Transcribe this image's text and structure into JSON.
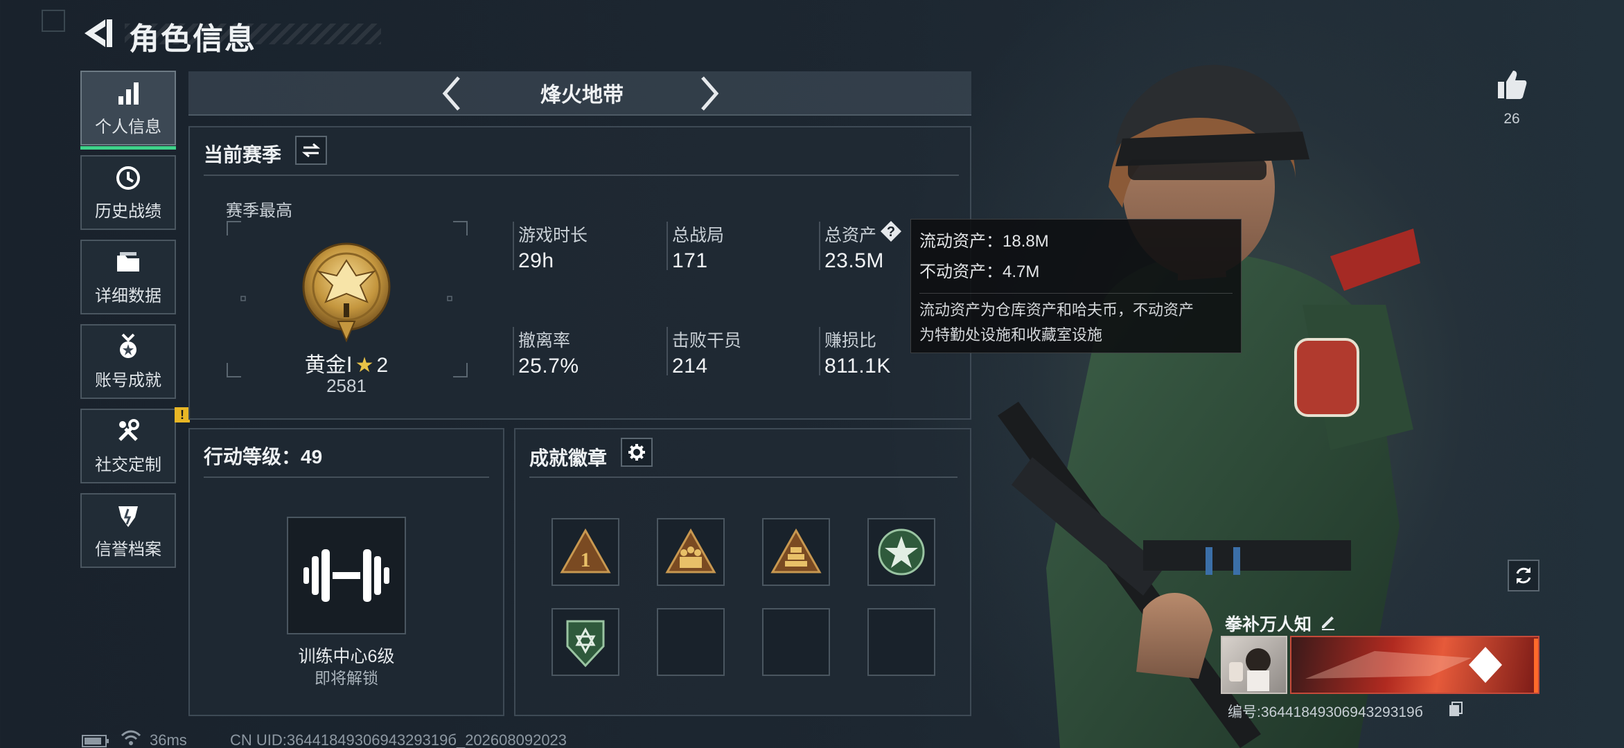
{
  "header": {
    "title": "角色信息"
  },
  "sidebar": {
    "items": [
      {
        "label": "个人信息",
        "icon": "bar-chart-icon",
        "active": true
      },
      {
        "label": "历史战绩",
        "icon": "history-icon"
      },
      {
        "label": "详细数据",
        "icon": "folder-icon"
      },
      {
        "label": "账号成就",
        "icon": "medal-icon"
      },
      {
        "label": "社交定制",
        "icon": "wrench-icon",
        "badge": "!"
      },
      {
        "label": "信誉档案",
        "icon": "shield-icon"
      }
    ]
  },
  "mode": {
    "name": "烽火地带"
  },
  "season": {
    "title": "当前赛季",
    "best_label": "赛季最高",
    "rank_name": "黄金Ⅰ",
    "rank_stars": "2",
    "rank_points": "2581",
    "stats": [
      {
        "label": "游戏时长",
        "value": "29h"
      },
      {
        "label": "总战局",
        "value": "171"
      },
      {
        "label": "总资产",
        "value": "23.5M"
      },
      {
        "label": "撤离率",
        "value": "25.7%"
      },
      {
        "label": "击败干员",
        "value": "214"
      },
      {
        "label": "赚损比",
        "value": "811.1K"
      }
    ]
  },
  "tooltip": {
    "liquid": "流动资产：18.8M",
    "fixed": "不动资产：4.7M",
    "desc_line1": "流动资产为仓库资产和哈夫币，不动资产",
    "desc_line2": "为特勤处设施和收藏室设施"
  },
  "action_level": {
    "title": "行动等级：49",
    "training_name": "训练中心6级",
    "training_status": "即将解锁"
  },
  "achievements": {
    "title": "成就徽章",
    "badges": [
      "badge-rank-1",
      "badge-squad",
      "badge-pyramid",
      "badge-star-circle",
      "badge-shield-green",
      "",
      "",
      ""
    ]
  },
  "player": {
    "likes": "26",
    "name": "拳补万人知",
    "id": "编号:3644184930694329319б"
  },
  "status_bar": {
    "ping": "36ms",
    "uid": "CN UID:3644184930694329319б_202608092023"
  },
  "colors": {
    "accent_green": "#3fd28a",
    "warn_yellow": "#e8b625",
    "panel_border": "#3e4a55"
  }
}
